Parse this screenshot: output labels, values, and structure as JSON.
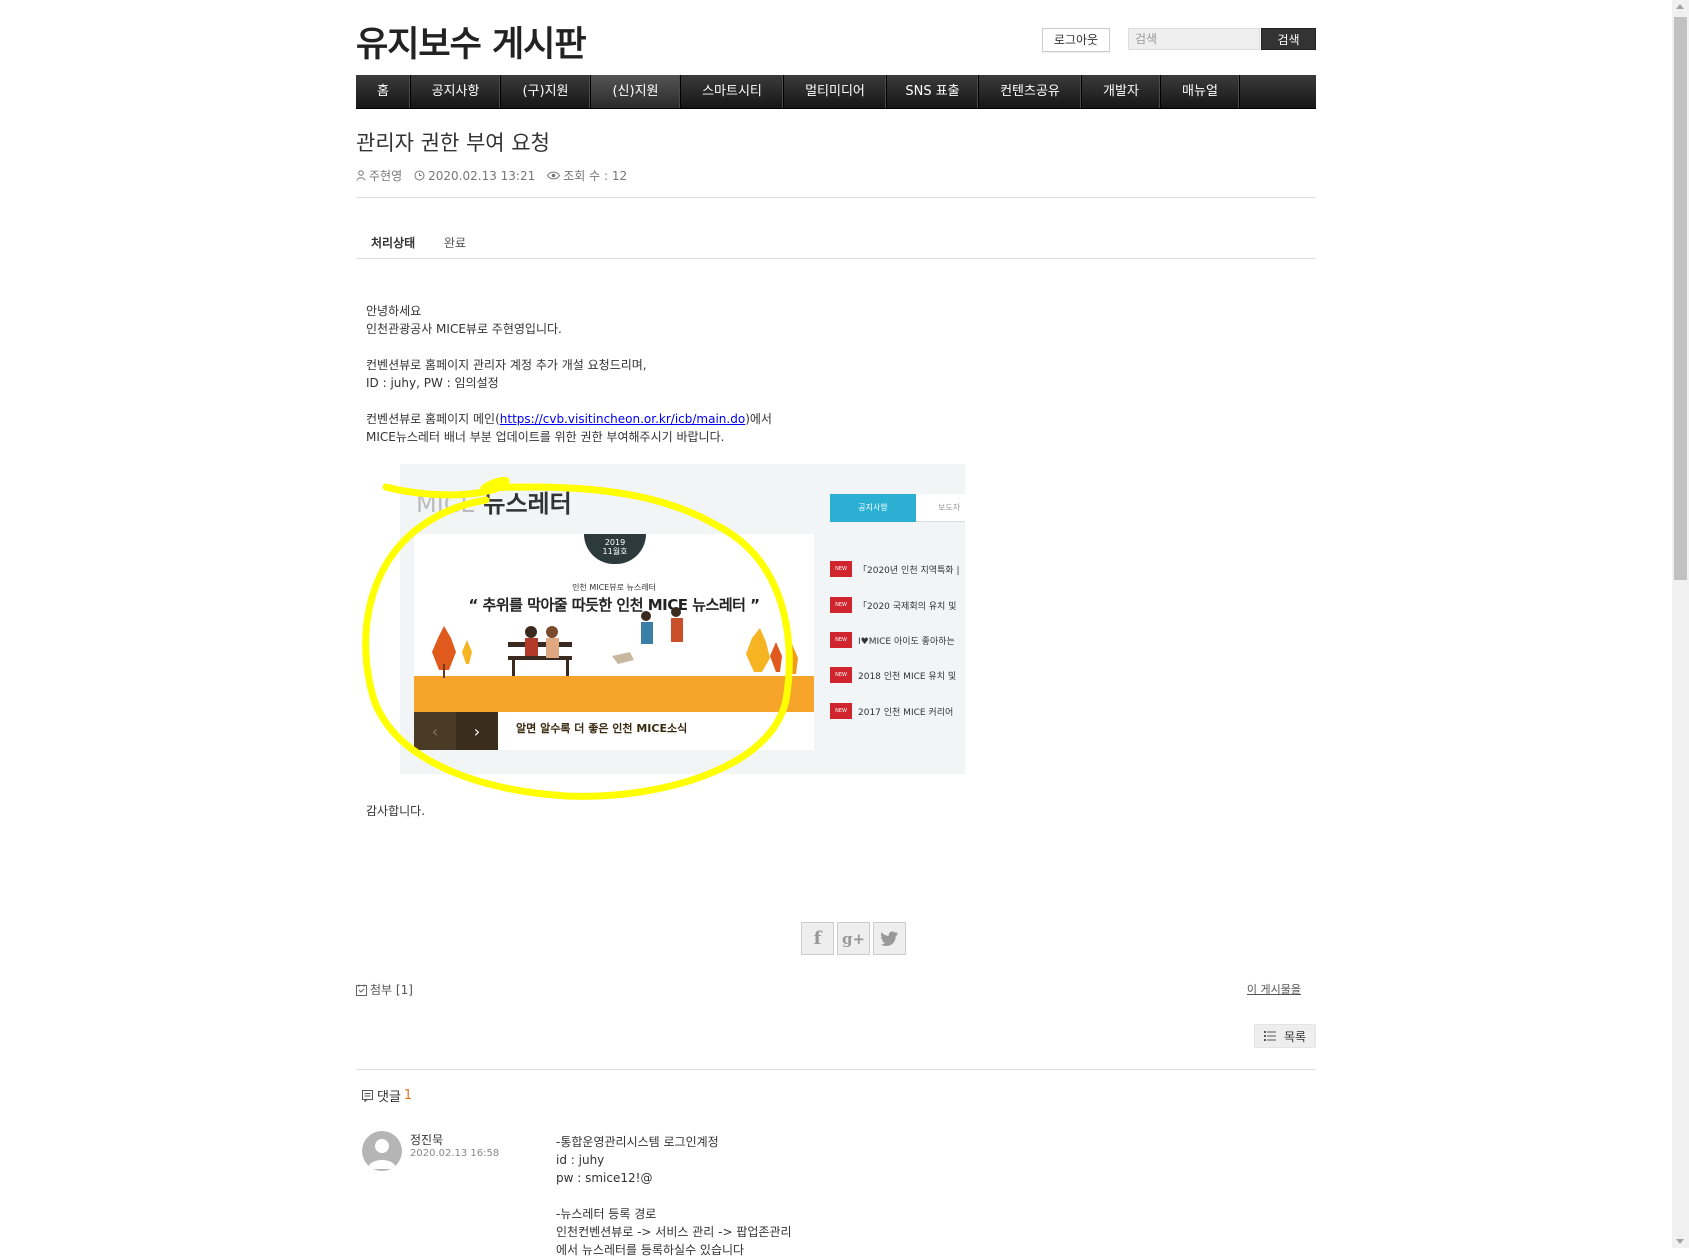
{
  "header": {
    "site_title": "유지보수 게시판",
    "logout_label": "로그아웃",
    "search_placeholder": "검색",
    "search_button": "검색"
  },
  "nav": {
    "items": [
      "홈",
      "공지사항",
      "(구)지원",
      "(신)지원",
      "스마트시티",
      "멀티미디어",
      "SNS 표출",
      "컨텐츠공유",
      "개발자",
      "매뉴얼"
    ],
    "active_index": 3
  },
  "post": {
    "title": "관리자 권한 부여 요청",
    "author": "주현영",
    "datetime": "2020.02.13 13:21",
    "views": "조회 수 : 12",
    "status_label": "처리상태",
    "status_value": "완료",
    "body": {
      "line1": "안녕하세요",
      "line2": "인천관광공사 MICE뷰로 주현영입니다.",
      "line3": "컨벤션뷰로 홈페이지 관리자 계정 추가 개설 요청드리며,",
      "line4": "ID : juhy, PW : 임의설정",
      "line5_pre": "컨벤션뷰로 홈페이지 메인(",
      "line5_link": "https://cvb.visitincheon.or.kr/icb/main.do",
      "line5_post": ")에서",
      "line6": "MICE뉴스레터 배너 부분 업데이트를 위한 권한 부여해주시기 바랍니다.",
      "closing": "감사합니다."
    },
    "embedded_image": {
      "title_light": "MICE",
      "title_bold": "뉴스레터",
      "badge_year": "2019",
      "badge_issue": "11월호",
      "banner_sub": "인천 MICE뷰로 뉴스레터",
      "banner_headline": "“ 추위를 막아줄 따듯한 인천 MICE 뉴스레터 ”",
      "banner_caption": "알면 알수록 더 좋은 인천 MICE소식",
      "tab_notice": "공지사항",
      "tab_press": "보도자",
      "news_badge": "NEW",
      "news": [
        "「2020년 인천 지역특화 |",
        "「2020 국제회의 유치 및",
        "I♥MICE 아이도 좋아하는",
        "2018 인천 MICE 유치 및",
        "2017 인천 MICE 커리어"
      ],
      "marker_color": "#ffff00"
    },
    "attachment_label": "첨부 [1]",
    "this_post_label": "이 게시물을",
    "list_button": "목록"
  },
  "comments": {
    "label": "댓글",
    "count": "1",
    "items": [
      {
        "author": "정진묵",
        "time": "2020.02.13 16:58",
        "lines": [
          "-통합운영관리시스템 로그인계정",
          "id : juhy",
          "pw : smice12!@",
          "",
          "-뉴스레터 등록 경로",
          "인천컨벤션뷰로 -> 서비스 관리 -> 팝업존관리",
          "에서 뉴스레터를 등록하실수 있습니다"
        ]
      }
    ]
  }
}
